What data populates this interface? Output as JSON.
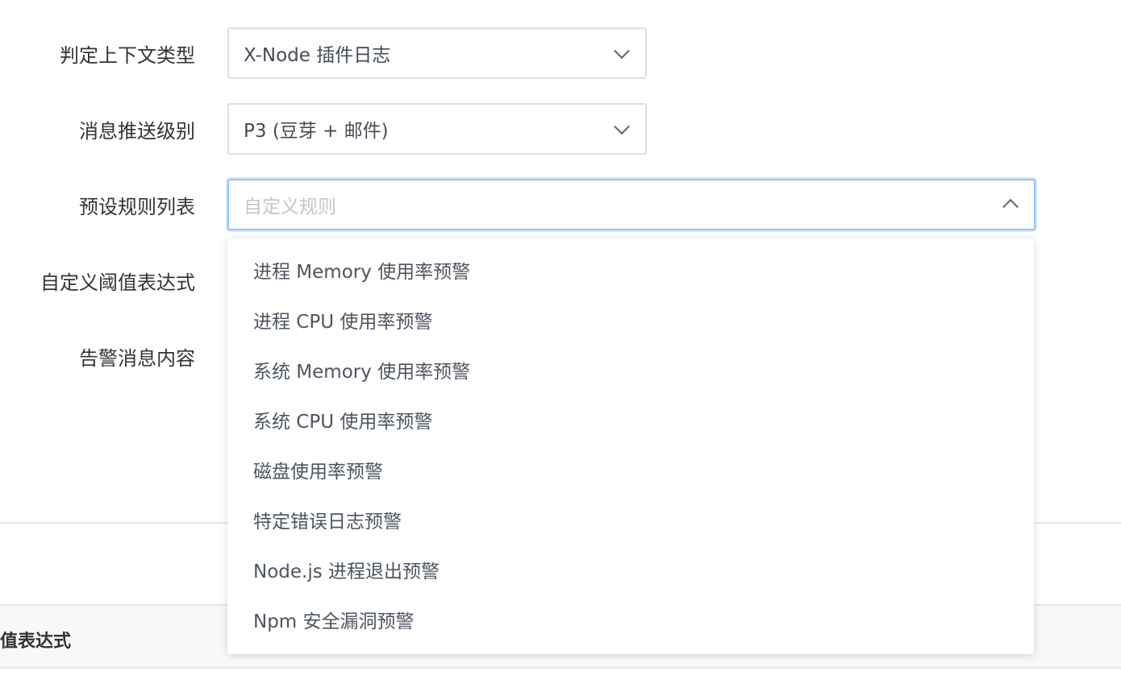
{
  "form": {
    "context_type": {
      "label": "判定上下文类型",
      "value": "X-Node 插件日志"
    },
    "push_level": {
      "label": "消息推送级别",
      "value": "P3 (豆芽 + 邮件)"
    },
    "preset_rules": {
      "label": "预设规则列表",
      "placeholder": "自定义规则"
    },
    "threshold_expr": {
      "label": "自定义阈值表达式"
    },
    "alert_content": {
      "label": "告警消息内容"
    }
  },
  "dropdown": {
    "options": [
      "进程 Memory 使用率预警",
      "进程 CPU 使用率预警",
      "系统 Memory 使用率预警",
      "系统 CPU 使用率预警",
      "磁盘使用率预警",
      "特定错误日志预警",
      "Node.js 进程退出预警",
      "Npm 安全漏洞预警"
    ]
  },
  "table": {
    "header_partial": "值表达式"
  },
  "icons": {
    "collapsed_arrow": "chevron-down-icon",
    "expanded_arrow": "chevron-up-icon"
  },
  "colors": {
    "focus_border": "#8ec4f7",
    "text": "#333333",
    "placeholder": "#c2c6cc"
  }
}
